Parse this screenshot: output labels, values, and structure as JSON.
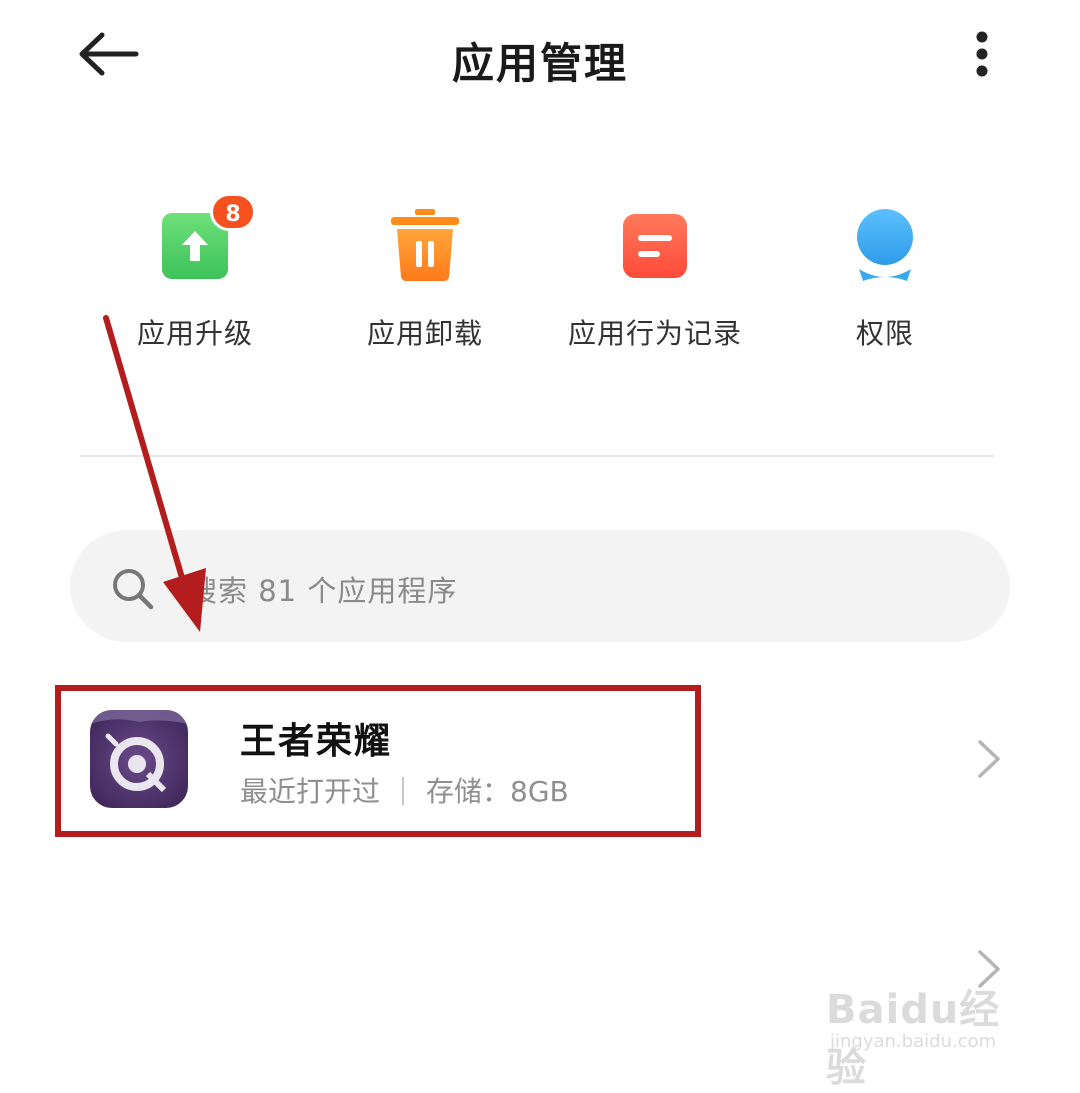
{
  "header": {
    "title": "应用管理"
  },
  "quick_actions": [
    {
      "label": "应用升级",
      "badge": "8",
      "icon": "upgrade-arrow-icon",
      "color": "#4cd964"
    },
    {
      "label": "应用卸载",
      "icon": "trash-icon",
      "color": "#ff8c1a"
    },
    {
      "label": "应用行为记录",
      "icon": "record-icon",
      "color": "#ff5a3c"
    },
    {
      "label": "权限",
      "icon": "permission-icon",
      "color": "#3aaaf0"
    }
  ],
  "search": {
    "placeholder": "搜索 81 个应用程序"
  },
  "app_list": [
    {
      "name": "王者荣耀",
      "status": "最近打开过",
      "storage": "存储：8GB",
      "icon": "app-icon-wangzhe"
    }
  ],
  "watermark": {
    "brand": "Baidu经验",
    "url": "jingyan.baidu.com"
  },
  "colors": {
    "highlight": "#b31d1d",
    "badge": "#f4511e"
  }
}
